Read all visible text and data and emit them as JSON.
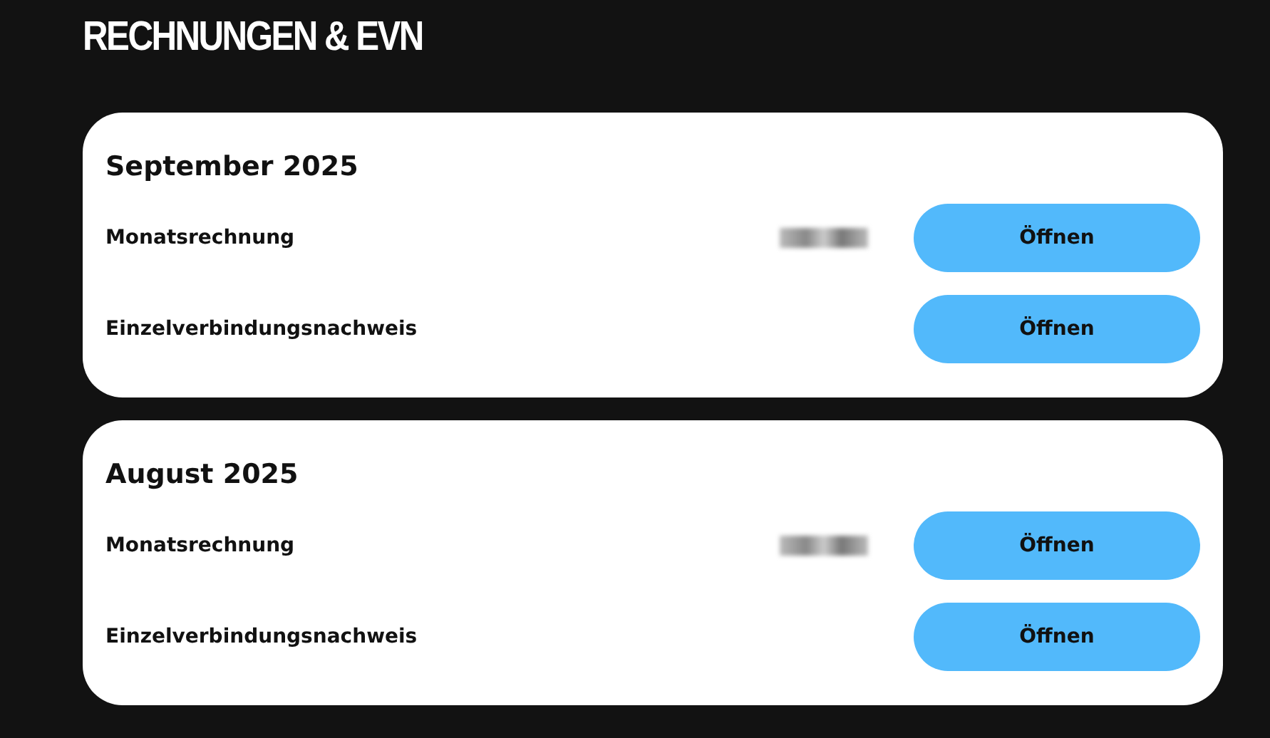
{
  "page_title": "RECHNUNGEN & EVN",
  "months": [
    {
      "title": "September 2025",
      "rows": [
        {
          "label": "Monatsrechnung",
          "amount_redacted": true,
          "button": "Öffnen"
        },
        {
          "label": "Einzelverbindungsnachweis",
          "amount_redacted": false,
          "button": "Öffnen"
        }
      ]
    },
    {
      "title": "August 2025",
      "rows": [
        {
          "label": "Monatsrechnung",
          "amount_redacted": true,
          "button": "Öffnen"
        },
        {
          "label": "Einzelverbindungsnachweis",
          "amount_redacted": false,
          "button": "Öffnen"
        }
      ]
    }
  ]
}
